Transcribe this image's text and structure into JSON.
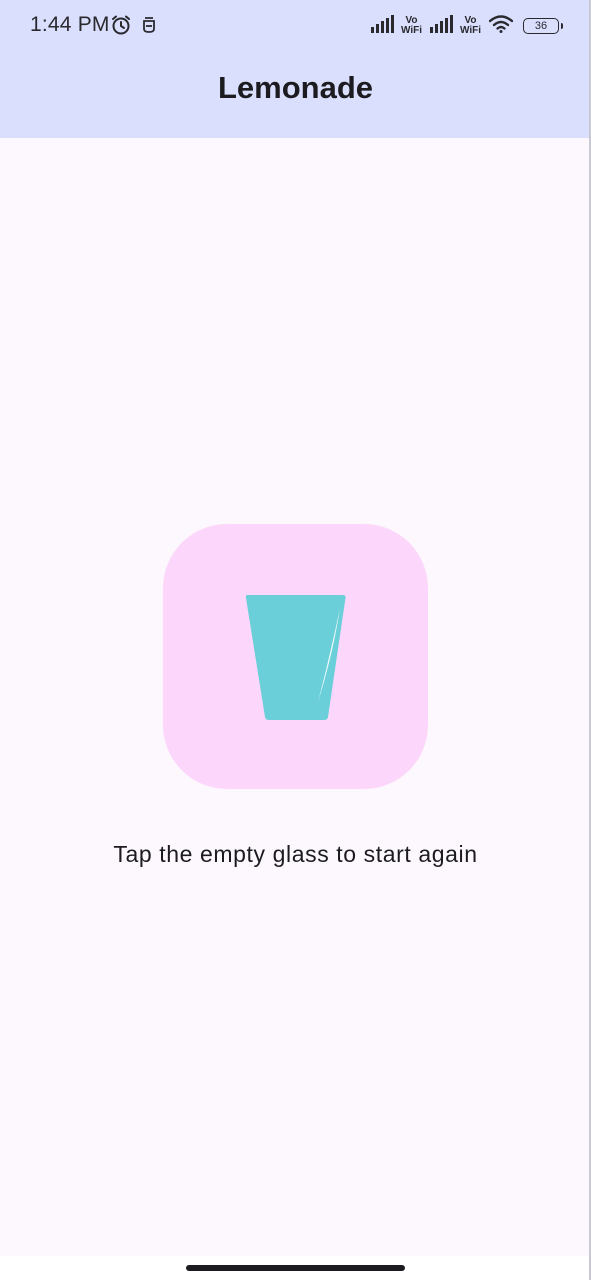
{
  "status_bar": {
    "time": "1:44 PM",
    "vowifi_1_top": "Vo",
    "vowifi_1_bottom": "WiFi",
    "vowifi_2_top": "Vo",
    "vowifi_2_bottom": "WiFi",
    "battery_level": "36",
    "icons": [
      "alarm-icon",
      "notification-icon",
      "signal-icon",
      "signal-icon",
      "wifi-icon",
      "battery-icon"
    ]
  },
  "app_bar": {
    "title": "Lemonade"
  },
  "main": {
    "image_button": {
      "icon": "empty-glass-icon",
      "background_color": "#fcd7fb",
      "glass_color": "#6acfd8"
    },
    "instruction": "Tap the empty glass to start again"
  },
  "colors": {
    "top_bar": "#dadffe",
    "background": "#fdf8fd",
    "text": "#1c1b1f"
  }
}
